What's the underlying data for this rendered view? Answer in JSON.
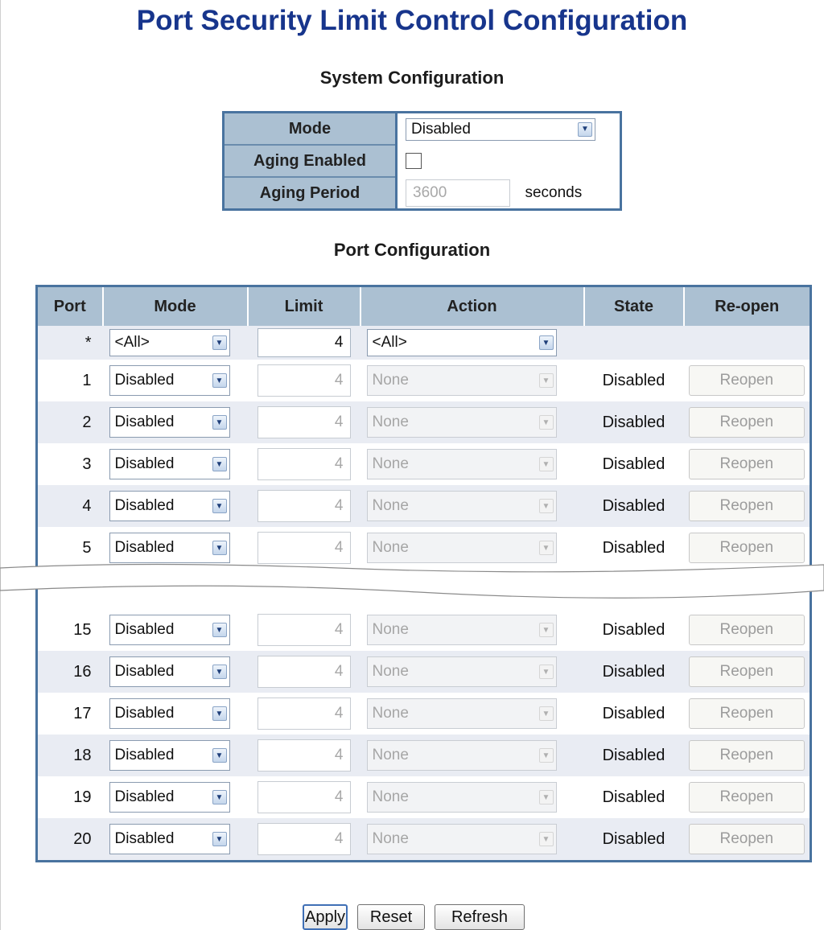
{
  "page": {
    "title": "Port Security Limit Control Configuration"
  },
  "system": {
    "title": "System Configuration",
    "mode_label": "Mode",
    "mode_value": "Disabled",
    "aging_enabled_label": "Aging Enabled",
    "aging_enabled_checked": false,
    "aging_period_label": "Aging Period",
    "aging_period_value": "3600",
    "aging_period_unit": "seconds"
  },
  "ports": {
    "title": "Port Configuration",
    "headers": {
      "port": "Port",
      "mode": "Mode",
      "limit": "Limit",
      "action": "Action",
      "state": "State",
      "reopen": "Re-open"
    },
    "all_row": {
      "port": "*",
      "mode": "<All>",
      "limit": "4",
      "action": "<All>"
    },
    "rows": [
      {
        "port": "1",
        "mode": "Disabled",
        "limit": "4",
        "action": "None",
        "state": "Disabled",
        "reopen": "Reopen"
      },
      {
        "port": "2",
        "mode": "Disabled",
        "limit": "4",
        "action": "None",
        "state": "Disabled",
        "reopen": "Reopen"
      },
      {
        "port": "3",
        "mode": "Disabled",
        "limit": "4",
        "action": "None",
        "state": "Disabled",
        "reopen": "Reopen"
      },
      {
        "port": "4",
        "mode": "Disabled",
        "limit": "4",
        "action": "None",
        "state": "Disabled",
        "reopen": "Reopen"
      },
      {
        "port": "5",
        "mode": "Disabled",
        "limit": "4",
        "action": "None",
        "state": "Disabled",
        "reopen": "Reopen"
      },
      {
        "port": "15",
        "mode": "Disabled",
        "limit": "4",
        "action": "None",
        "state": "Disabled",
        "reopen": "Reopen"
      },
      {
        "port": "16",
        "mode": "Disabled",
        "limit": "4",
        "action": "None",
        "state": "Disabled",
        "reopen": "Reopen"
      },
      {
        "port": "17",
        "mode": "Disabled",
        "limit": "4",
        "action": "None",
        "state": "Disabled",
        "reopen": "Reopen"
      },
      {
        "port": "18",
        "mode": "Disabled",
        "limit": "4",
        "action": "None",
        "state": "Disabled",
        "reopen": "Reopen"
      },
      {
        "port": "19",
        "mode": "Disabled",
        "limit": "4",
        "action": "None",
        "state": "Disabled",
        "reopen": "Reopen"
      },
      {
        "port": "20",
        "mode": "Disabled",
        "limit": "4",
        "action": "None",
        "state": "Disabled",
        "reopen": "Reopen"
      }
    ]
  },
  "buttons": {
    "apply": "Apply",
    "reset": "Reset",
    "refresh": "Refresh"
  },
  "colors": {
    "title": "#17358c",
    "header_bg": "#abc0d2",
    "border": "#49739f",
    "row_shade": "#e9ecf3"
  }
}
